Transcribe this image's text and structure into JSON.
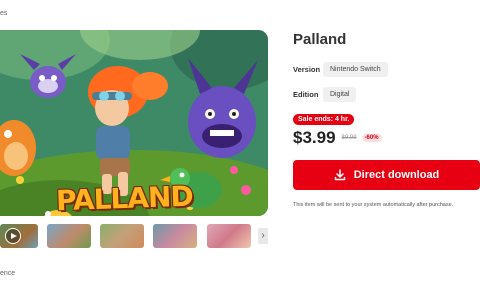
{
  "breadcrumb": {
    "text": "es"
  },
  "game": {
    "logo_text": "PALLAND",
    "title": "Palland",
    "version_label": "Version",
    "version_value": "Nintendo Switch",
    "edition_label": "Edition",
    "edition_value": "Digital",
    "sale_badge": "Sale ends: 4 hr.",
    "price": "$3.99",
    "old_price": "$9.99",
    "discount": "-60%",
    "download_label": "Direct download",
    "note": "This item will be sent to your system automatically after purchase."
  },
  "footer": {
    "text": "ence"
  },
  "icons": {
    "play": "play-icon",
    "next": "chevron-right-icon",
    "download": "download-icon"
  },
  "colors": {
    "accent": "#e60012",
    "chip_bg": "#f0f0f0",
    "discount_bg": "#fde0e2"
  }
}
